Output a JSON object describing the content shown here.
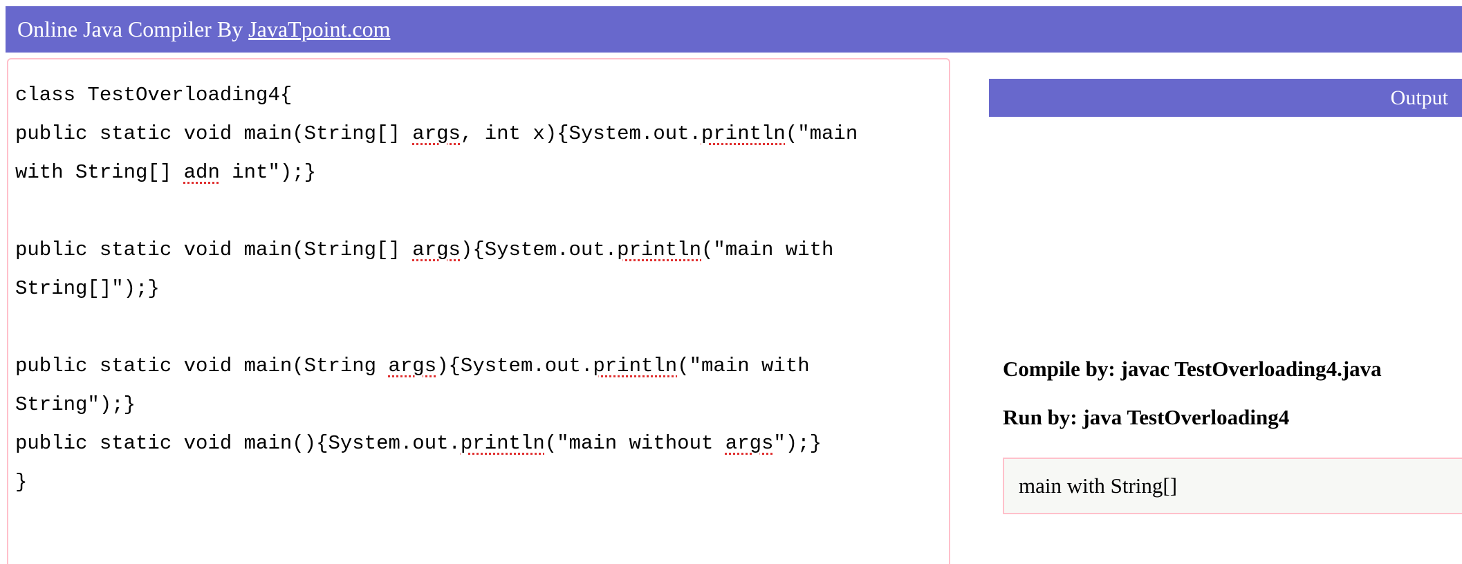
{
  "header": {
    "title": "Online Java Compiler By ",
    "link": "JavaTpoint.com"
  },
  "editor": {
    "lines": [
      [
        {
          "t": "class TestOverloading4{"
        }
      ],
      [
        {
          "t": "public static void main(String[] "
        },
        {
          "t": "args",
          "sq": true
        },
        {
          "t": ", int x){System.out."
        },
        {
          "t": "println",
          "sq": true
        },
        {
          "t": "(\"main"
        }
      ],
      [
        {
          "t": "with String[] "
        },
        {
          "t": "adn",
          "sq": true
        },
        {
          "t": " int\");}"
        }
      ],
      [
        {
          "t": ""
        }
      ],
      [
        {
          "t": "public static void main(String[] "
        },
        {
          "t": "args",
          "sq": true
        },
        {
          "t": "){System.out."
        },
        {
          "t": "println",
          "sq": true
        },
        {
          "t": "(\"main with"
        }
      ],
      [
        {
          "t": "String[]\");}"
        }
      ],
      [
        {
          "t": ""
        }
      ],
      [
        {
          "t": "public static void main(String "
        },
        {
          "t": "args",
          "sq": true
        },
        {
          "t": "){System.out."
        },
        {
          "t": "println",
          "sq": true
        },
        {
          "t": "(\"main with"
        }
      ],
      [
        {
          "t": "String\");}"
        }
      ],
      [
        {
          "t": "public static void main(){System.out."
        },
        {
          "t": "println",
          "sq": true
        },
        {
          "t": "(\"main without "
        },
        {
          "t": "args",
          "sq": true
        },
        {
          "t": "\");}"
        }
      ],
      [
        {
          "t": "}"
        }
      ]
    ]
  },
  "output": {
    "label": "Output",
    "compile_by": "Compile by: javac TestOverloading4.java",
    "run_by": "Run by: java TestOverloading4",
    "result": "main with String[]"
  },
  "colors": {
    "accent": "#6868cc",
    "border": "#ffc0cb",
    "spellcheck": "#e03030"
  }
}
